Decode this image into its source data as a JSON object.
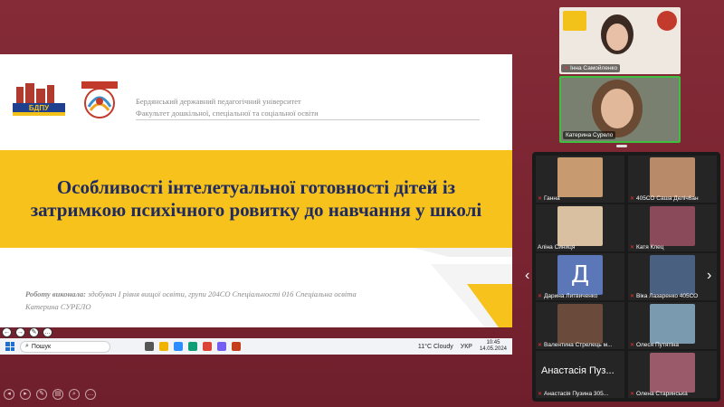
{
  "slide": {
    "logo_text": "БДПУ",
    "university": "Бердянський державний педагогічний університет",
    "faculty": "Факультет дошкільної, спеціальної та соціальної освіти",
    "title": "Особливості інтелетуальної готовності дітей із затримкою психічного ровитку до навчання у школі",
    "author_label": "Роботу виконала:",
    "author_text": " здобувач I рівня вищої освіти, групи 204СО Спеціальності 016 Спеціальна освіта Катерина СУРЕЛО"
  },
  "taskbar": {
    "search_placeholder": "Пошук",
    "weather": "11°C Cloudy",
    "lang": "УКР",
    "time": "10:45",
    "date": "14.05.2024"
  },
  "participants": {
    "speaker_top": "Інна Самойленко",
    "speaker_active": "Катерина Сурело",
    "gallery": [
      {
        "name": "Ганна",
        "muted": true
      },
      {
        "name": "405СО Саша Деліч6ан",
        "muted": true
      },
      {
        "name": "Аліна Синиця",
        "muted": false
      },
      {
        "name": "Катя Клец",
        "muted": true
      },
      {
        "name": "Дарина Литвиченко",
        "muted": true,
        "initial": "Д"
      },
      {
        "name": "Віка Лазаренко 405СО",
        "muted": true
      },
      {
        "name": "Валентина Стрелець м...",
        "muted": true
      },
      {
        "name": "Олеся Путятіна",
        "muted": true
      },
      {
        "name": "Анастасія Пузина 305...",
        "muted": true,
        "big_label": "Анастасія Пуз..."
      },
      {
        "name": "Олена Старинська",
        "muted": true
      }
    ]
  },
  "colors": {
    "background": "#7e2733",
    "band": "#f6c21b",
    "title": "#1f2a60",
    "active_border": "#3fbf3f"
  }
}
